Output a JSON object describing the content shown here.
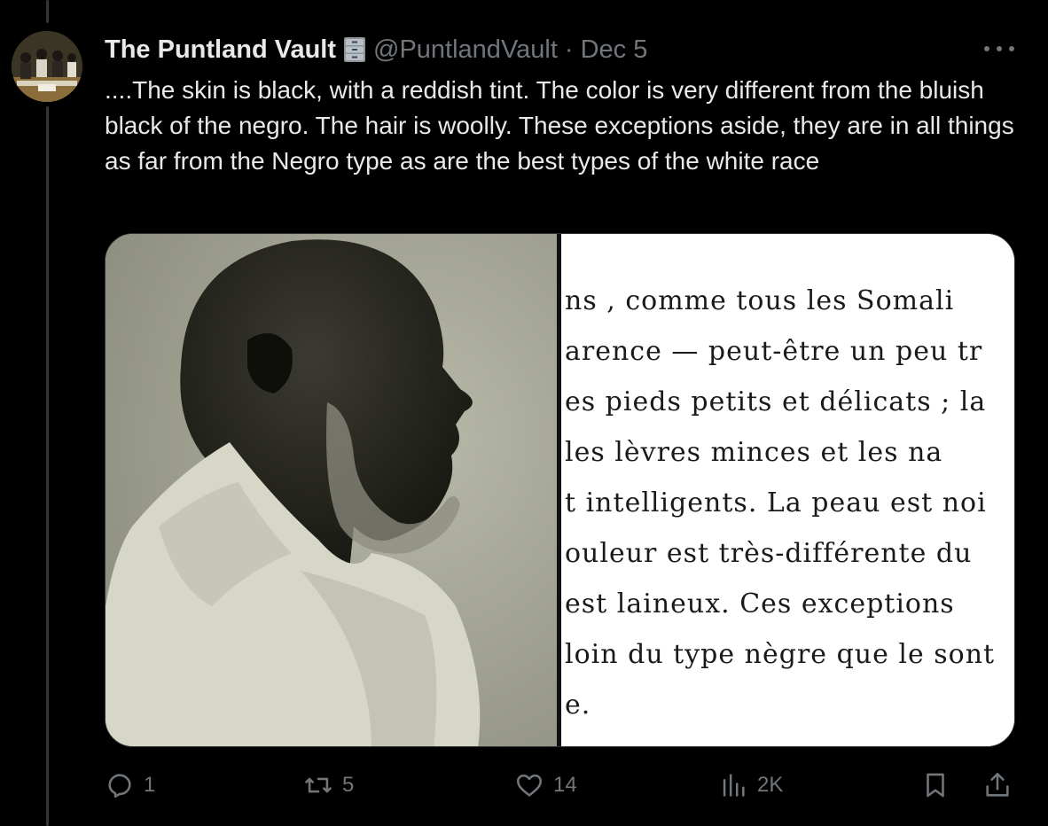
{
  "tweet": {
    "display_name": "The Puntland Vault",
    "badge_icon": "file-cabinet-emoji",
    "handle": "@PuntlandVault",
    "separator": "·",
    "date": "Dec 5",
    "text": "....The skin is black, with a reddish tint. The color is very different from the bluish black of the negro. The hair is woolly. These exceptions aside, they are in all things as far from the Negro type as are the best types of the white race"
  },
  "media": {
    "photo": "portrait-photo",
    "scan_lines": [
      "ns ,  comme  tous  les  Somali",
      "arence  —  peut-être  un  peu  tr",
      "es  pieds  petits  et  délicats ;  la",
      " les  lèvres  minces  et  les  na",
      "t  intelligents.  La  peau  est  noi",
      "ouleur  est  très-différente  du",
      "est  laineux.  Ces  exceptions",
      " loin  du  type  nègre  que  le  sont",
      "e."
    ]
  },
  "actions": {
    "reply_count": "1",
    "retweet_count": "5",
    "like_count": "14",
    "views_count": "2K"
  },
  "colors": {
    "background": "#000000",
    "text": "#e7e9ea",
    "muted": "#71767b",
    "border": "#2f3336"
  }
}
